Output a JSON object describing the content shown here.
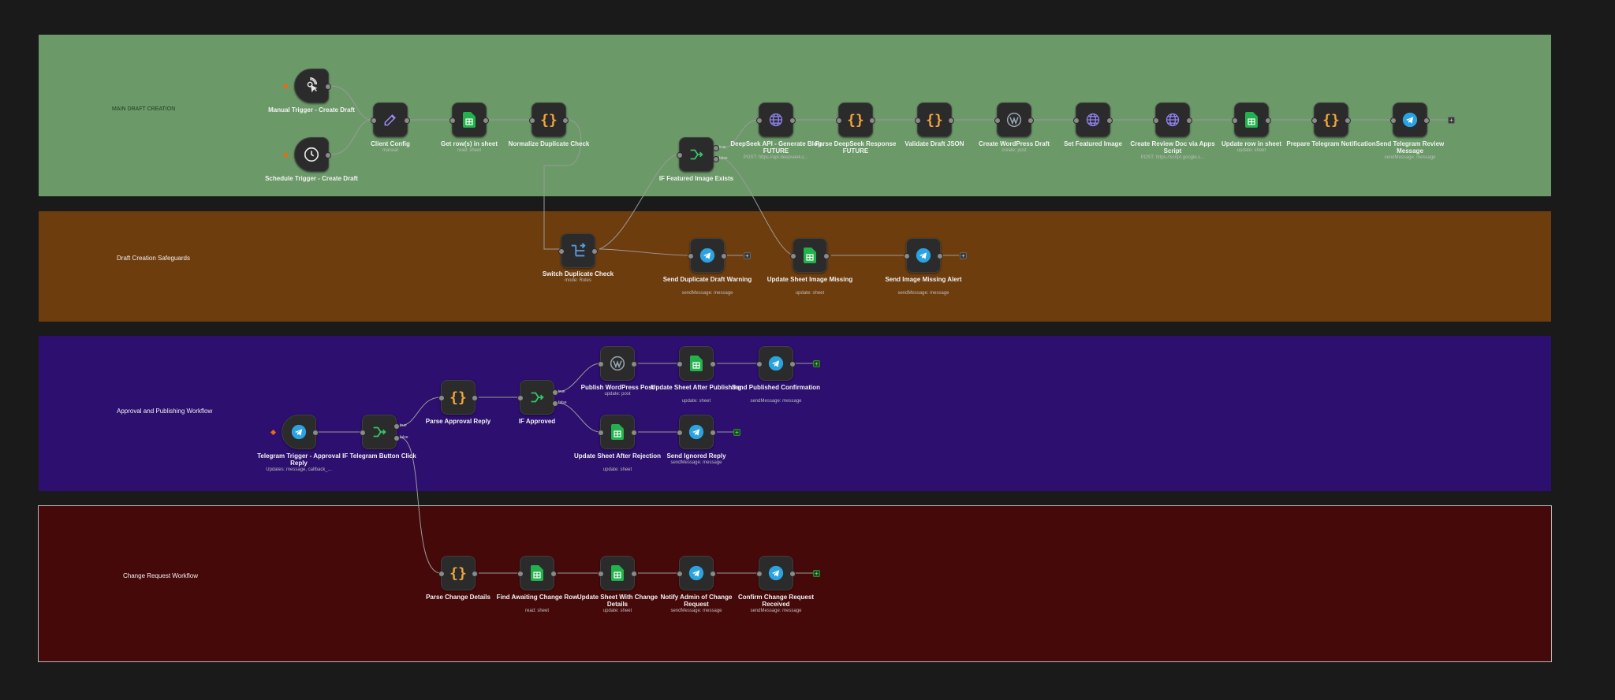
{
  "colors": {
    "bg": "#1a1a1a",
    "group_main": "#6b9a68",
    "group_safeguards": "#6e3d0e",
    "group_approval": "#2c0f6e",
    "group_change": "#460909",
    "wire": "#a9a9a9",
    "sheets_green": "#22b14c",
    "telegram_blue": "#2aa3e0",
    "code_orange": "#f0a53d",
    "http_purple": "#8e82f0",
    "switch_blue": "#5a9de0",
    "if_green": "#35c46a",
    "trigger_orange": "#e66a1a"
  },
  "groups": [
    {
      "id": "main",
      "label": "MAIN DRAFT CREATION"
    },
    {
      "id": "safeguards",
      "label": "Draft Creation Safeguards"
    },
    {
      "id": "approval",
      "label": "Approval and Publishing Workflow"
    },
    {
      "id": "change",
      "label": "Change Request Workflow"
    }
  ],
  "branch_labels": {
    "true": "true",
    "false": "false"
  },
  "nodes": [
    {
      "id": "manual",
      "title": "Manual Trigger - Create Draft",
      "sub": "",
      "icon": "cursor-click-icon"
    },
    {
      "id": "schedule",
      "title": "Schedule Trigger - Create Draft",
      "sub": "",
      "icon": "clock-icon"
    },
    {
      "id": "client",
      "title": "Client Config",
      "sub": "manual",
      "icon": "edit-icon"
    },
    {
      "id": "getrows",
      "title": "Get row(s) in sheet",
      "sub": "read: sheet",
      "icon": "sheets-icon"
    },
    {
      "id": "normalize",
      "title": "Normalize Duplicate Check",
      "sub": "",
      "icon": "code-braces-icon"
    },
    {
      "id": "iffeat",
      "title": "IF Featured Image Exists",
      "sub": "",
      "icon": "if-branch-icon"
    },
    {
      "id": "deepseek",
      "title": "DeepSeek API - Generate Blog FUTURE",
      "sub": "POST: https://api.deepseek.c...",
      "icon": "globe-icon"
    },
    {
      "id": "parseds",
      "title": "Parse DeepSeek Response FUTURE",
      "sub": "",
      "icon": "code-braces-icon"
    },
    {
      "id": "validate",
      "title": "Validate Draft JSON",
      "sub": "",
      "icon": "code-braces-icon"
    },
    {
      "id": "wpdraft",
      "title": "Create WordPress Draft",
      "sub": "create: post",
      "icon": "wordpress-icon"
    },
    {
      "id": "setimg",
      "title": "Set Featured Image",
      "sub": "",
      "icon": "globe-icon"
    },
    {
      "id": "reviewdoc",
      "title": "Create Review Doc via Apps Script",
      "sub": "POST: https://script.google.c...",
      "icon": "globe-icon"
    },
    {
      "id": "updaterow",
      "title": "Update row in sheet",
      "sub": "update: sheet",
      "icon": "sheets-icon"
    },
    {
      "id": "preptg",
      "title": "Prepare Telegram Notification",
      "sub": "",
      "icon": "code-braces-icon"
    },
    {
      "id": "sendreview",
      "title": "Send Telegram Review Message",
      "sub": "sendMessage: message",
      "icon": "telegram-icon"
    },
    {
      "id": "switchdup",
      "title": "Switch Duplicate Check",
      "sub": "mode: Rules",
      "icon": "switch-icon"
    },
    {
      "id": "dupwarn",
      "title": "Send Duplicate Draft Warning",
      "sub": "sendMessage: message",
      "icon": "telegram-icon"
    },
    {
      "id": "sheetmiss",
      "title": "Update Sheet Image Missing",
      "sub": "update: sheet",
      "icon": "sheets-icon"
    },
    {
      "id": "imgalert",
      "title": "Send Image Missing Alert",
      "sub": "sendMessage: message",
      "icon": "telegram-icon"
    },
    {
      "id": "tgtrigger",
      "title": "Telegram Trigger - Approval Reply",
      "sub": "Updates: message, callback_...",
      "icon": "telegram-icon"
    },
    {
      "id": "iftgbtn",
      "title": "IF Telegram Button Click",
      "sub": "",
      "icon": "if-branch-icon"
    },
    {
      "id": "parseappr",
      "title": "Parse Approval Reply",
      "sub": "",
      "icon": "code-braces-icon"
    },
    {
      "id": "ifappr",
      "title": "IF Approved",
      "sub": "",
      "icon": "if-branch-icon"
    },
    {
      "id": "pubwp",
      "title": "Publish WordPress Post",
      "sub": "update: post",
      "icon": "wordpress-icon"
    },
    {
      "id": "sheetpub",
      "title": "Update Sheet After Publishing",
      "sub": "update: sheet",
      "icon": "sheets-icon"
    },
    {
      "id": "sendpub",
      "title": "Send Published Confirmation",
      "sub": "sendMessage: message",
      "icon": "telegram-icon"
    },
    {
      "id": "sheetrej",
      "title": "Update Sheet After Rejection",
      "sub": "update: sheet",
      "icon": "sheets-icon"
    },
    {
      "id": "sendign",
      "title": "Send Ignored Reply",
      "sub": "sendMessage: message",
      "icon": "telegram-icon"
    },
    {
      "id": "parsechg",
      "title": "Parse Change Details",
      "sub": "",
      "icon": "code-braces-icon"
    },
    {
      "id": "findrow",
      "title": "Find Awaiting Change Row",
      "sub": "read: sheet",
      "icon": "sheets-icon"
    },
    {
      "id": "sheetchg",
      "title": "Update Sheet With Change Details",
      "sub": "update: sheet",
      "icon": "sheets-icon"
    },
    {
      "id": "notifyadm",
      "title": "Notify Admin of Change Request",
      "sub": "sendMessage: message",
      "icon": "telegram-icon"
    },
    {
      "id": "confirmchg",
      "title": "Confirm Change Request Received",
      "sub": "sendMessage: message",
      "icon": "telegram-icon"
    }
  ]
}
